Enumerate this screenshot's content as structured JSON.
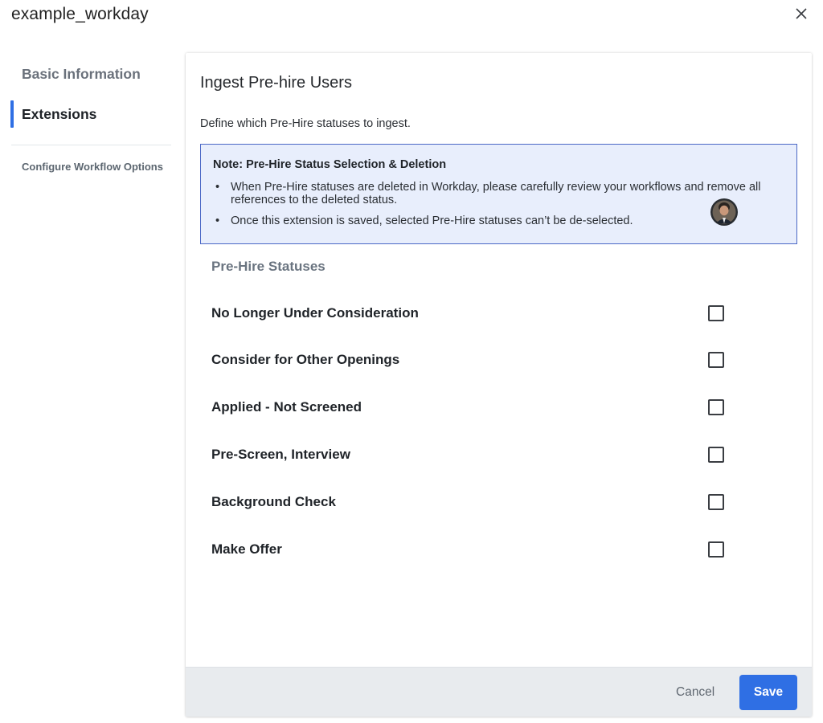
{
  "window": {
    "title": "example_workday",
    "close_icon": "close-icon"
  },
  "sidebar": {
    "items": [
      {
        "label": "Basic Information",
        "active": false
      },
      {
        "label": "Extensions",
        "active": true
      }
    ],
    "config_link": "Configure Workflow Options"
  },
  "panel": {
    "title": "Ingest Pre-hire Users",
    "description": "Define which Pre-Hire statuses to ingest.",
    "note": {
      "title": "Note: Pre-Hire Status Selection & Deletion",
      "bullets": [
        "When Pre-Hire statuses are deleted in Workday, please carefully review your workflows and remove all references to the deleted status.",
        "Once this extension is saved, selected Pre-Hire statuses can’t be de-selected."
      ]
    },
    "statuses_label": "Pre-Hire Statuses",
    "statuses": [
      {
        "label": "No Longer Under Consideration",
        "checked": false
      },
      {
        "label": "Consider for Other Openings",
        "checked": false
      },
      {
        "label": "Applied - Not Screened",
        "checked": false
      },
      {
        "label": "Pre-Screen, Interview",
        "checked": false
      },
      {
        "label": "Background Check",
        "checked": false
      },
      {
        "label": "Make Offer",
        "checked": false
      }
    ]
  },
  "footer": {
    "cancel_label": "Cancel",
    "save_label": "Save"
  },
  "colors": {
    "accent": "#2f6fe4",
    "note_bg": "#e8eefc",
    "note_border": "#4b68c6",
    "footer_bg": "#e8ebee"
  }
}
